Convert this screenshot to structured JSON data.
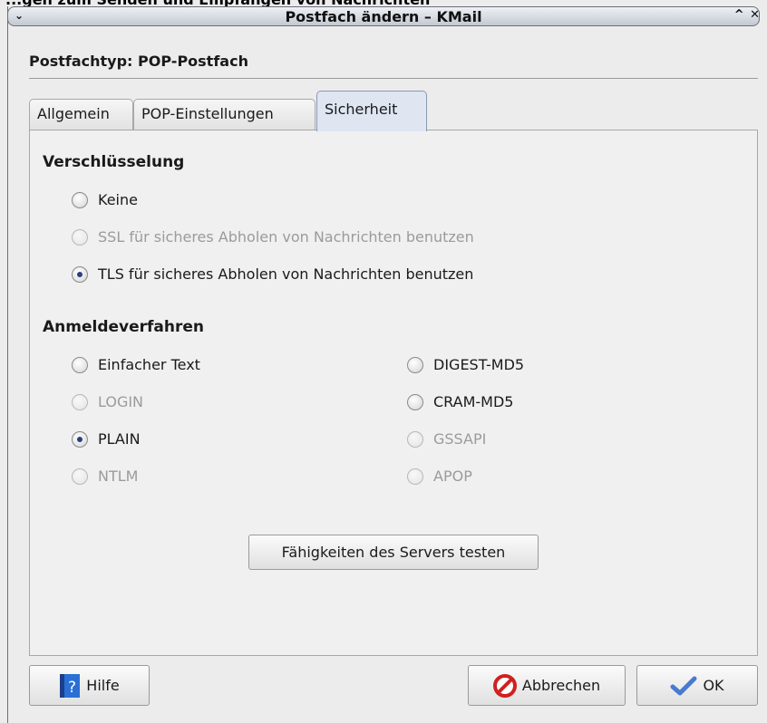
{
  "background_window": {
    "title": "...gen zum Senden und Empfangen von Nachrichten"
  },
  "window": {
    "title": "Postfach ändern – KMail",
    "menu_glyph": "⌄",
    "right_glyphs": "^ ✕"
  },
  "account_type": "Postfachtyp: POP-Postfach",
  "tabs": [
    {
      "label": "Allgemein",
      "active": false
    },
    {
      "label": "POP-Einstellungen",
      "active": false
    },
    {
      "label": "Sicherheit",
      "active": true
    }
  ],
  "encryption": {
    "title": "Verschlüsselung",
    "options": [
      {
        "label": "Keine",
        "checked": false,
        "enabled": true
      },
      {
        "label": "SSL für sicheres Abholen von Nachrichten benutzen",
        "checked": false,
        "enabled": false
      },
      {
        "label": "TLS für sicheres Abholen von Nachrichten benutzen",
        "checked": true,
        "enabled": true
      }
    ]
  },
  "auth": {
    "title": "Anmeldeverfahren",
    "left": [
      {
        "label": "Einfacher Text",
        "checked": false,
        "enabled": true
      },
      {
        "label": "LOGIN",
        "checked": false,
        "enabled": false
      },
      {
        "label": "PLAIN",
        "checked": true,
        "enabled": true
      },
      {
        "label": "NTLM",
        "checked": false,
        "enabled": false
      }
    ],
    "right": [
      {
        "label": "DIGEST-MD5",
        "checked": false,
        "enabled": true
      },
      {
        "label": "CRAM-MD5",
        "checked": false,
        "enabled": true
      },
      {
        "label": "GSSAPI",
        "checked": false,
        "enabled": false
      },
      {
        "label": "APOP",
        "checked": false,
        "enabled": false
      }
    ]
  },
  "test_button": "Fähigkeiten des Servers testen",
  "buttons": {
    "help": "Hilfe",
    "cancel": "Abbrechen",
    "ok": "OK"
  },
  "colors": {
    "active_tab": "#dfe6f2",
    "disabled_text": "#9b9b9b",
    "radio_dot": "#2a3f7a",
    "help_icon": "#2a6fd6",
    "cancel_icon": "#d02020",
    "ok_icon": "#4a7ad0"
  }
}
